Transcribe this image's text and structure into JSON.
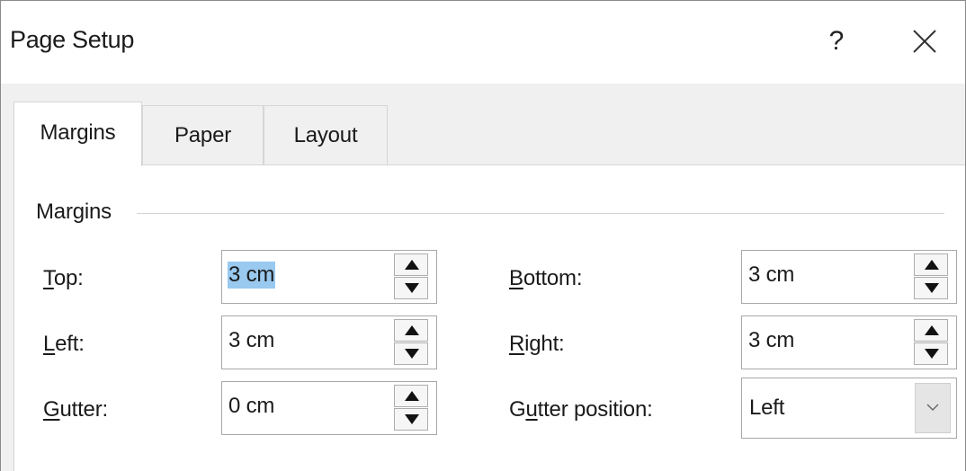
{
  "dialog": {
    "title": "Page Setup",
    "help_glyph": "?",
    "close_icon": "close-icon"
  },
  "tabs": [
    {
      "label": "Margins",
      "active": true
    },
    {
      "label": "Paper",
      "active": false
    },
    {
      "label": "Layout",
      "active": false
    }
  ],
  "margins": {
    "group_label": "Margins",
    "top": {
      "label": "Top:",
      "mnemonic": "T",
      "rest": "op:",
      "value": "3 cm",
      "selected": true
    },
    "bottom": {
      "label": "Bottom:",
      "mnemonic": "B",
      "rest": "ottom:",
      "value": "3 cm"
    },
    "left": {
      "label": "Left:",
      "mnemonic": "L",
      "rest": "eft:",
      "value": "3 cm"
    },
    "right": {
      "label": "Right:",
      "mnemonic": "R",
      "rest": "ight:",
      "value": "3 cm"
    },
    "gutter": {
      "label": "Gutter:",
      "mnemonic": "G",
      "rest": "utter:",
      "value": "0 cm"
    },
    "gutter_position": {
      "label": "Gutter position:",
      "pre": "G",
      "mnemonic": "u",
      "rest": "tter position:",
      "value": "Left"
    }
  },
  "colors": {
    "selection": "#99c9ef",
    "dialog_background": "#f0f0f0"
  }
}
